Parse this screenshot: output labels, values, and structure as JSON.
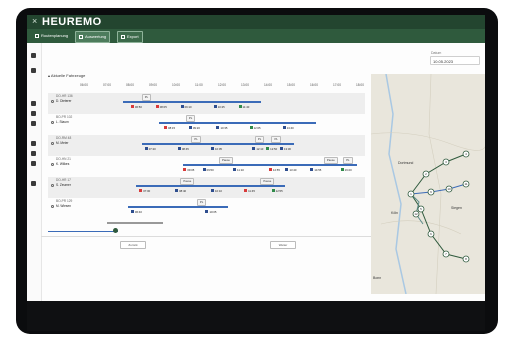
{
  "app": {
    "name": "HEUREMO",
    "close_glyph": "×"
  },
  "toolbar": {
    "items": [
      {
        "label": "Routenplanung"
      },
      {
        "label": "Auswertung"
      },
      {
        "label": "Export"
      }
    ]
  },
  "date_picker": {
    "label": "Datum",
    "value": "10.05.2023"
  },
  "panel": {
    "title": "Aktuelle Fahrzeuge"
  },
  "timeline": {
    "ticks": [
      "06:00",
      "07:00",
      "08:00",
      "09:00",
      "10:00",
      "11:00",
      "12:00",
      "13:00",
      "14:00",
      "15:00",
      "16:00",
      "17:00",
      "18:00"
    ]
  },
  "vehicles": [
    {
      "id": "DO-HR 136",
      "driver": "D. Dieterer",
      "chips": [
        {
          "label": "PL",
          "pos": 0.22
        }
      ],
      "segments": [
        {
          "from": 0.14,
          "to": 0.64
        }
      ],
      "stops": [
        {
          "c": "red",
          "pos": 0.17,
          "time": "06:50"
        },
        {
          "c": "red",
          "pos": 0.26,
          "time": "08:05"
        },
        {
          "c": "blue",
          "pos": 0.35,
          "time": "09:10"
        },
        {
          "c": "blue",
          "pos": 0.47,
          "time": "10:25"
        },
        {
          "c": "green",
          "pos": 0.56,
          "time": "11:40"
        }
      ]
    },
    {
      "id": "BO-PR 102",
      "driver": "L. Staum",
      "chips": [
        {
          "label": "PL",
          "pos": 0.38
        }
      ],
      "segments": [
        {
          "from": 0.27,
          "to": 0.84
        }
      ],
      "stops": [
        {
          "c": "red",
          "pos": 0.29,
          "time": "08:15"
        },
        {
          "c": "blue",
          "pos": 0.38,
          "time": "09:20"
        },
        {
          "c": "blue",
          "pos": 0.48,
          "time": "10:35"
        },
        {
          "c": "green",
          "pos": 0.6,
          "time": "12:05"
        },
        {
          "c": "blue",
          "pos": 0.72,
          "time": "13:40"
        }
      ]
    },
    {
      "id": "DO-RM 48",
      "driver": "M. Meier",
      "chips": [
        {
          "label": "PL",
          "pos": 0.4
        },
        {
          "label": "PL",
          "pos": 0.63
        },
        {
          "label": "PL",
          "pos": 0.69
        }
      ],
      "segments": [
        {
          "from": 0.21,
          "to": 0.76
        }
      ],
      "stops": [
        {
          "c": "blue",
          "pos": 0.22,
          "time": "07:20"
        },
        {
          "c": "blue",
          "pos": 0.34,
          "time": "08:45"
        },
        {
          "c": "blue",
          "pos": 0.46,
          "time": "10:05"
        },
        {
          "c": "blue",
          "pos": 0.61,
          "time": "12:10"
        },
        {
          "c": "green",
          "pos": 0.66,
          "time": "12:50"
        },
        {
          "c": "blue",
          "pos": 0.71,
          "time": "13:30"
        }
      ]
    },
    {
      "id": "DO-HN 21",
      "driver": "K. Wilkes",
      "chips": [
        {
          "label": "Pause",
          "pos": 0.5
        },
        {
          "label": "Pause",
          "pos": 0.88
        },
        {
          "label": "PL",
          "pos": 0.95
        }
      ],
      "segments": [
        {
          "from": 0.36,
          "to": 0.99
        }
      ],
      "stops": [
        {
          "c": "red",
          "pos": 0.36,
          "time": "09:05"
        },
        {
          "c": "blue",
          "pos": 0.43,
          "time": "09:50"
        },
        {
          "c": "blue",
          "pos": 0.54,
          "time": "11:10"
        },
        {
          "c": "red",
          "pos": 0.67,
          "time": "12:55"
        },
        {
          "c": "blue",
          "pos": 0.73,
          "time": "13:40"
        },
        {
          "c": "blue",
          "pos": 0.82,
          "time": "14:55"
        },
        {
          "c": "green",
          "pos": 0.93,
          "time": "16:20"
        }
      ]
    },
    {
      "id": "DO-HR 17",
      "driver": "S. Zeumer",
      "chips": [
        {
          "label": "Pause",
          "pos": 0.36
        },
        {
          "label": "Pause",
          "pos": 0.65
        }
      ],
      "segments": [
        {
          "from": 0.19,
          "to": 0.73
        }
      ],
      "stops": [
        {
          "c": "red",
          "pos": 0.2,
          "time": "07:00"
        },
        {
          "c": "blue",
          "pos": 0.33,
          "time": "08:40"
        },
        {
          "c": "blue",
          "pos": 0.46,
          "time": "10:10"
        },
        {
          "c": "red",
          "pos": 0.58,
          "time": "11:45"
        },
        {
          "c": "green",
          "pos": 0.68,
          "time": "12:55"
        }
      ]
    },
    {
      "id": "BO-PR 129",
      "driver": "M. Wiesen",
      "chips": [
        {
          "label": "PL",
          "pos": 0.42
        }
      ],
      "segments": [
        {
          "from": 0.16,
          "to": 0.52
        }
      ],
      "stops": [
        {
          "c": "blue",
          "pos": 0.17,
          "time": "06:40"
        },
        {
          "c": "blue",
          "pos": 0.44,
          "time": "10:05"
        }
      ]
    }
  ],
  "footer": {
    "prev_label": "Zurück",
    "next_label": "Weiter"
  },
  "map": {
    "colors": {
      "land": "#e9e6dc",
      "water": "#a9c8e3",
      "primary": "#2f5a3d",
      "route2": "#3b6bb8",
      "route3": "#5c8c8a"
    },
    "cities": [
      {
        "name": "Köln"
      },
      {
        "name": "Siegen"
      },
      {
        "name": "Bonn"
      },
      {
        "name": "Dortmund"
      }
    ],
    "stop_numbers": [
      "1",
      "2",
      "3",
      "4",
      "5",
      "6",
      "7",
      "8",
      "9",
      "10",
      "11",
      "12"
    ]
  }
}
